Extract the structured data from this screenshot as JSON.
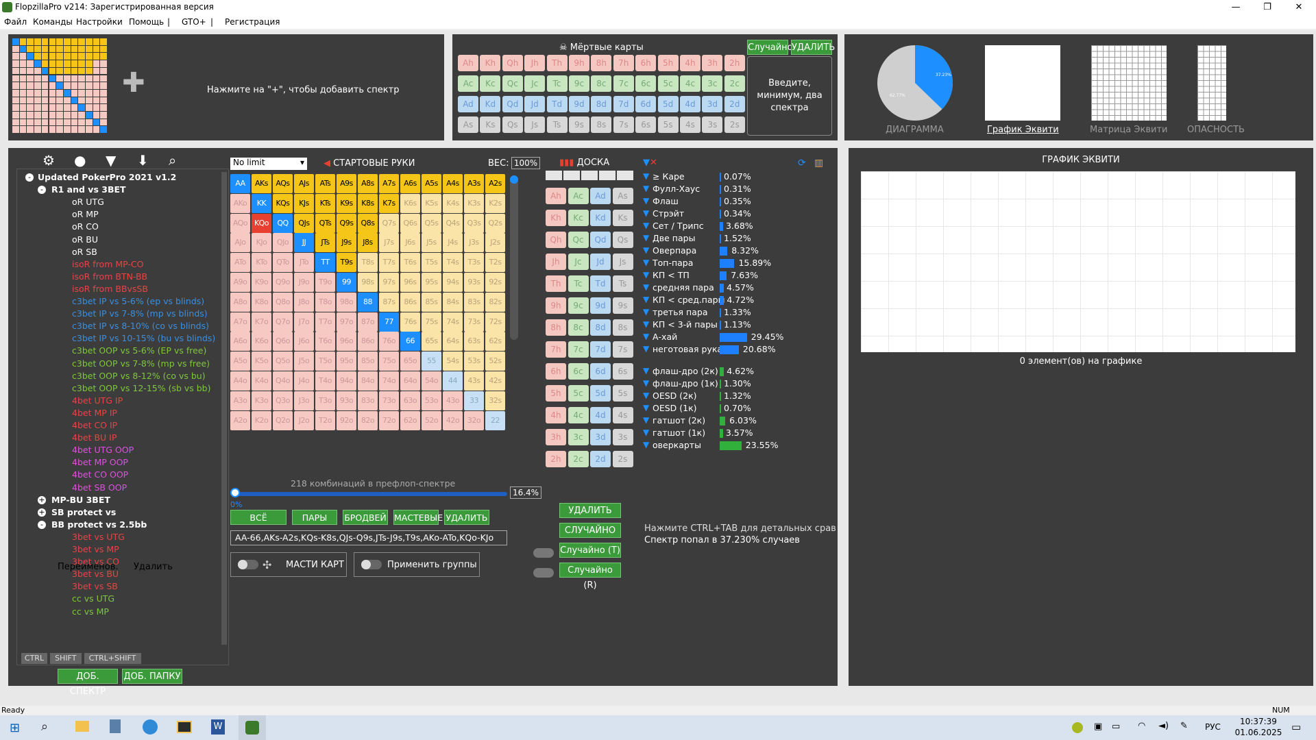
{
  "window": {
    "title": "FlopzillaPro v214: Зарегистрированная версия"
  },
  "menu": [
    "Файл",
    "Команды",
    "Настройки",
    "Помощь",
    "|",
    "GTO+",
    "|",
    "Регистрация"
  ],
  "range_panel": {
    "hint": "Нажмите на \"+\", чтобы добавить спектр"
  },
  "dead_cards": {
    "title": "Мёртвые карты",
    "random": "Случайно",
    "delete": "УДАЛИТЬ",
    "prompt": "Введите, минимум, два спектра",
    "rows": [
      [
        "Ah",
        "Kh",
        "Qh",
        "Jh",
        "Th",
        "9h",
        "8h",
        "7h",
        "6h",
        "5h",
        "4h",
        "3h",
        "2h"
      ],
      [
        "Ac",
        "Kc",
        "Qc",
        "Jc",
        "Tc",
        "9c",
        "8c",
        "7c",
        "6c",
        "5c",
        "4c",
        "3c",
        "2c"
      ],
      [
        "Ad",
        "Kd",
        "Qd",
        "Jd",
        "Td",
        "9d",
        "8d",
        "7d",
        "6d",
        "5d",
        "4d",
        "3d",
        "2d"
      ],
      [
        "As",
        "Ks",
        "Qs",
        "Js",
        "Ts",
        "9s",
        "8s",
        "7s",
        "6s",
        "5s",
        "4s",
        "3s",
        "2s"
      ]
    ]
  },
  "views": [
    {
      "label": "ДИАГРАММА"
    },
    {
      "label": "График Эквити"
    },
    {
      "label": "Матрица Эквити"
    },
    {
      "label": "ОПАСНОСТЬ"
    }
  ],
  "pie": {
    "a": "37.23%",
    "b": "62.77%",
    "blue_fraction": 0.3723
  },
  "toolbar_icons": [
    "gear-icon",
    "user-icon",
    "filter-icon",
    "download-icon",
    "search-icon"
  ],
  "tree": [
    {
      "t": "Updated PokerPro 2021 v1.2",
      "c": "#ffffff",
      "d": 0,
      "b": true,
      "s": "-"
    },
    {
      "t": "R1 and vs 3BET",
      "c": "#ffffff",
      "d": 1,
      "b": true,
      "s": "-"
    },
    {
      "t": "oR UTG",
      "c": "#ffffff",
      "d": 2
    },
    {
      "t": "oR MP",
      "c": "#ffffff",
      "d": 2
    },
    {
      "t": "oR CO",
      "c": "#ffffff",
      "d": 2
    },
    {
      "t": "oR BU",
      "c": "#ffffff",
      "d": 2
    },
    {
      "t": "oR SB",
      "c": "#ffffff",
      "d": 2
    },
    {
      "t": "isoR from MP-CO",
      "c": "#e84444",
      "d": 2
    },
    {
      "t": "isoR from BTN-BB",
      "c": "#e84444",
      "d": 2
    },
    {
      "t": "isoR from BBvsSB",
      "c": "#e84444",
      "d": 2
    },
    {
      "t": "c3bet IP vs 5-6% (ep vs blinds)",
      "c": "#3a8fe0",
      "d": 2
    },
    {
      "t": "c3bet IP vs 7-8% (mp vs blinds)",
      "c": "#3a8fe0",
      "d": 2
    },
    {
      "t": "c3bet IP vs 8-10% (co vs blinds)",
      "c": "#3a8fe0",
      "d": 2
    },
    {
      "t": "c3bet IP vs 10-15% (bu vs blinds)",
      "c": "#3a8fe0",
      "d": 2
    },
    {
      "t": "c3bet OOP vs 5-6% (EP vs free)",
      "c": "#7ec83a",
      "d": 2
    },
    {
      "t": "c3bet OOP vs 7-8% (mp vs free)",
      "c": "#7ec83a",
      "d": 2
    },
    {
      "t": "c3bet OOP vs 8-12% (co vs bu)",
      "c": "#7ec83a",
      "d": 2
    },
    {
      "t": "c3bet OOP vs 12-15% (sb vs bb)",
      "c": "#7ec83a",
      "d": 2
    },
    {
      "t": "4bet UTG IP",
      "c": "#e84444",
      "d": 2
    },
    {
      "t": "4bet MP IP",
      "c": "#e84444",
      "d": 2
    },
    {
      "t": "4bet CO IP",
      "c": "#e84444",
      "d": 2
    },
    {
      "t": "4bet BU IP",
      "c": "#e84444",
      "d": 2
    },
    {
      "t": "4bet UTG OOP",
      "c": "#e050e0",
      "d": 2
    },
    {
      "t": "4bet MP OOP",
      "c": "#e050e0",
      "d": 2
    },
    {
      "t": "4bet CO OOP",
      "c": "#e050e0",
      "d": 2
    },
    {
      "t": "4bet SB OOP",
      "c": "#e050e0",
      "d": 2
    },
    {
      "t": "MP-BU 3BET",
      "c": "#ffffff",
      "d": 1,
      "b": true,
      "s": "+"
    },
    {
      "t": "SB protect vs",
      "c": "#ffffff",
      "d": 1,
      "b": true,
      "s": "+"
    },
    {
      "t": "BB protect vs 2.5bb",
      "c": "#ffffff",
      "d": 1,
      "b": true,
      "s": "-"
    },
    {
      "t": "3bet vs UTG",
      "c": "#e84444",
      "d": 2
    },
    {
      "t": "3bet vs MP",
      "c": "#e84444",
      "d": 2
    },
    {
      "t": "3bet vs CO",
      "c": "#e84444",
      "d": 2
    },
    {
      "t": "3bet vs BU",
      "c": "#e84444",
      "d": 2
    },
    {
      "t": "3bet vs SB",
      "c": "#e84444",
      "d": 2
    },
    {
      "t": "cc vs UTG",
      "c": "#7ec83a",
      "d": 2
    },
    {
      "t": "cc vs MP",
      "c": "#7ec83a",
      "d": 2
    }
  ],
  "keys": [
    "CTRL",
    "SHIFT",
    "CTRL+SHIFT"
  ],
  "tree_buttons": {
    "add_range": "ДОБ. СПЕКТР",
    "add_folder": "ДОБ. ПАПКУ",
    "rename": "Переименов.",
    "delete": "Удалить"
  },
  "preflop": {
    "mode": "No limit",
    "title": "СТАРТОВЫЕ РУКИ",
    "weight_label": "ВЕС:",
    "weight": "100%",
    "combos": "218 комбинаций в префлоп-спектре",
    "pct": "16.4%",
    "slider_zero": "0%",
    "buttons": [
      "ВСЁ",
      "ПАРЫ",
      "БРОДВЕЙ",
      "МАСТЕВЫЕ",
      "УДАЛИТЬ"
    ],
    "range_text": "AA-66,AKs-A2s,KQs-K8s,QJs-Q9s,JTs-J9s,T9s,AKo-ATo,KQo-KJo",
    "suits_label": "МАСТИ КАРТ",
    "groups_label": "Применить группы"
  },
  "board": {
    "title": "ДОСКА",
    "delete": "УДАЛИТЬ",
    "random": "СЛУЧАЙНО",
    "random_t": "Случайно (T)",
    "random_r": "Случайно (R)",
    "cols": [
      [
        "Ah",
        "Kh",
        "Qh",
        "Jh",
        "Th",
        "9h",
        "8h",
        "7h",
        "6h",
        "5h",
        "4h",
        "3h",
        "2h"
      ],
      [
        "Ac",
        "Kc",
        "Qc",
        "Jc",
        "Tc",
        "9c",
        "8c",
        "7c",
        "6c",
        "5c",
        "4c",
        "3c",
        "2c"
      ],
      [
        "Ad",
        "Kd",
        "Qd",
        "Jd",
        "Td",
        "9d",
        "8d",
        "7d",
        "6d",
        "5d",
        "4d",
        "3d",
        "2d"
      ],
      [
        "As",
        "Ks",
        "Qs",
        "Js",
        "Ts",
        "9s",
        "8s",
        "7s",
        "6s",
        "5s",
        "4s",
        "3s",
        "2s"
      ]
    ]
  },
  "stats": [
    {
      "n": "≥ Каре",
      "v": "0.07%",
      "p": 0.07
    },
    {
      "n": "Фулл-Хаус",
      "v": "0.31%",
      "p": 0.31
    },
    {
      "n": "Флаш",
      "v": "0.35%",
      "p": 0.35
    },
    {
      "n": "Стрэйт",
      "v": "0.34%",
      "p": 0.34
    },
    {
      "n": "Сет / Трипс",
      "v": "3.68%",
      "p": 3.68
    },
    {
      "n": "Две пары",
      "v": "1.52%",
      "p": 1.52
    },
    {
      "n": "Оверпара",
      "v": "8.32%",
      "p": 8.32
    },
    {
      "n": "Топ-пара",
      "v": "15.89%",
      "p": 15.89
    },
    {
      "n": "КП < ТП",
      "v": "7.63%",
      "p": 7.63
    },
    {
      "n": "средняя пара",
      "v": "4.57%",
      "p": 4.57
    },
    {
      "n": "КП < сред.пары",
      "v": "4.72%",
      "p": 4.72
    },
    {
      "n": "третья пара",
      "v": "1.33%",
      "p": 1.33
    },
    {
      "n": "КП < 3-й пары",
      "v": "1.13%",
      "p": 1.13
    },
    {
      "n": "А-хай",
      "v": "29.45%",
      "p": 29.45
    },
    {
      "n": "неготовая рука",
      "v": "20.68%",
      "p": 20.68
    }
  ],
  "draws": [
    {
      "n": "флаш-дро (2к)",
      "v": "4.62%",
      "p": 4.62
    },
    {
      "n": "флаш-дро (1к)",
      "v": "1.30%",
      "p": 1.3
    },
    {
      "n": "OESD (2к)",
      "v": "1.32%",
      "p": 1.32
    },
    {
      "n": "OESD (1к)",
      "v": "0.70%",
      "p": 0.7
    },
    {
      "n": "гатшот (2к)",
      "v": "6.03%",
      "p": 6.03
    },
    {
      "n": "гатшот (1к)",
      "v": "3.57%",
      "p": 3.57
    },
    {
      "n": "оверкарты",
      "v": "23.55%",
      "p": 23.55
    }
  ],
  "notes": {
    "ctrl_tab": "Нажмите CTRL+TAB для детальных сравнений",
    "hit": "Спектр попал в 37.230% случаев"
  },
  "equity": {
    "title": "ГРАФИК ЭКВИТИ",
    "count": "0 элемент(ов) на графике"
  },
  "status": {
    "ready": "Ready",
    "num": "NUM"
  },
  "taskbar": {
    "lang": "РУС",
    "time": "10:37:39",
    "date": "01.06.2025"
  },
  "colors": {
    "panel": "#3c3c3c",
    "pair": "#1e8fff",
    "suited": "#f5c518",
    "offsuit": "#e84030",
    "green": "#3b9b3b"
  }
}
